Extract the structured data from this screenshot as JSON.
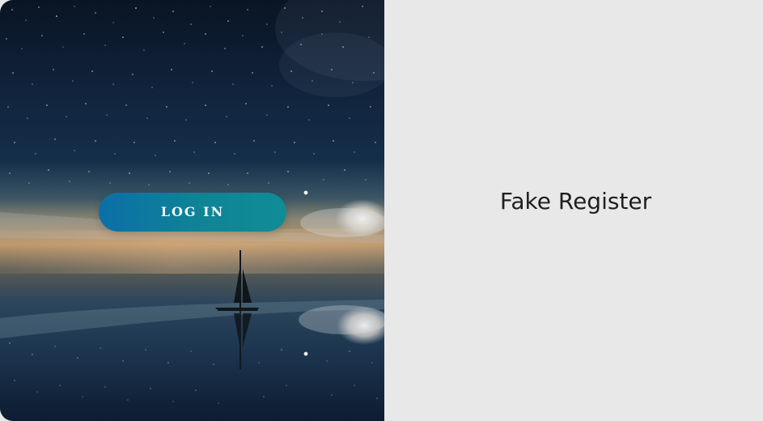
{
  "login": {
    "button_label": "LOG IN"
  },
  "register": {
    "label": "Fake Register"
  },
  "colors": {
    "button_start": "#0b6fa8",
    "button_end": "#0f8d97",
    "background": "#e8e8e8",
    "text": "#1f1f1f"
  }
}
